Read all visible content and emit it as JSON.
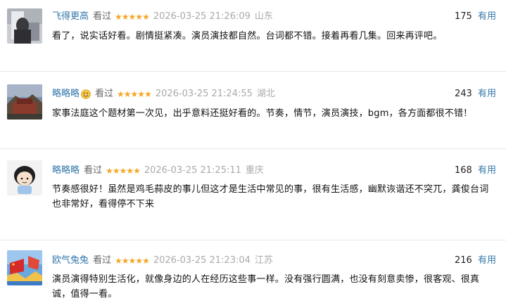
{
  "reviews": [
    {
      "username": "飞得更高",
      "status": "看过",
      "stars": "★★★★★",
      "time": "2026-03-25 21:26:09",
      "location": "山东",
      "useful_count": "175",
      "useful_label": "有用",
      "content": "看了，说实话好看。剧情挺紧凑。演员演技都自然。台词都不错。接着再看几集。回来再评吧。"
    },
    {
      "username": "略略略",
      "status": "看过",
      "stars": "★★★★★",
      "time": "2026-03-25 21:24:55",
      "location": "湖北",
      "useful_count": "243",
      "useful_label": "有用",
      "content": "家事法庭这个题材第一次见，出乎意料还挺好看的。节奏，情节，演员演技，bgm，各方面都很不错！"
    },
    {
      "username": "略略略",
      "status": "看过",
      "stars": "★★★★★",
      "time": "2026-03-25 21:25:11",
      "location": "重庆",
      "useful_count": "168",
      "useful_label": "有用",
      "content": "节奏感很好！虽然是鸡毛蒜皮的事儿但这才是生活中常见的事，很有生活感，幽默诙谐还不突兀，龚俊台词也非常好，看得停不下来"
    },
    {
      "username": "欧气兔兔",
      "status": "看过",
      "stars": "★★★★★",
      "time": "2026-03-25 21:23:04",
      "location": "江苏",
      "useful_count": "216",
      "useful_label": "有用",
      "content": "演员演得特别生活化，就像身边的人在经历这些事一样。没有强行圆满，也没有刻意卖惨，很客观、很真诚，值得一看。"
    }
  ],
  "colors": {
    "username": "#3377aa",
    "star": "#f5a623",
    "meta_gray": "#aaaaaa",
    "divider": "#e8e8e8"
  }
}
